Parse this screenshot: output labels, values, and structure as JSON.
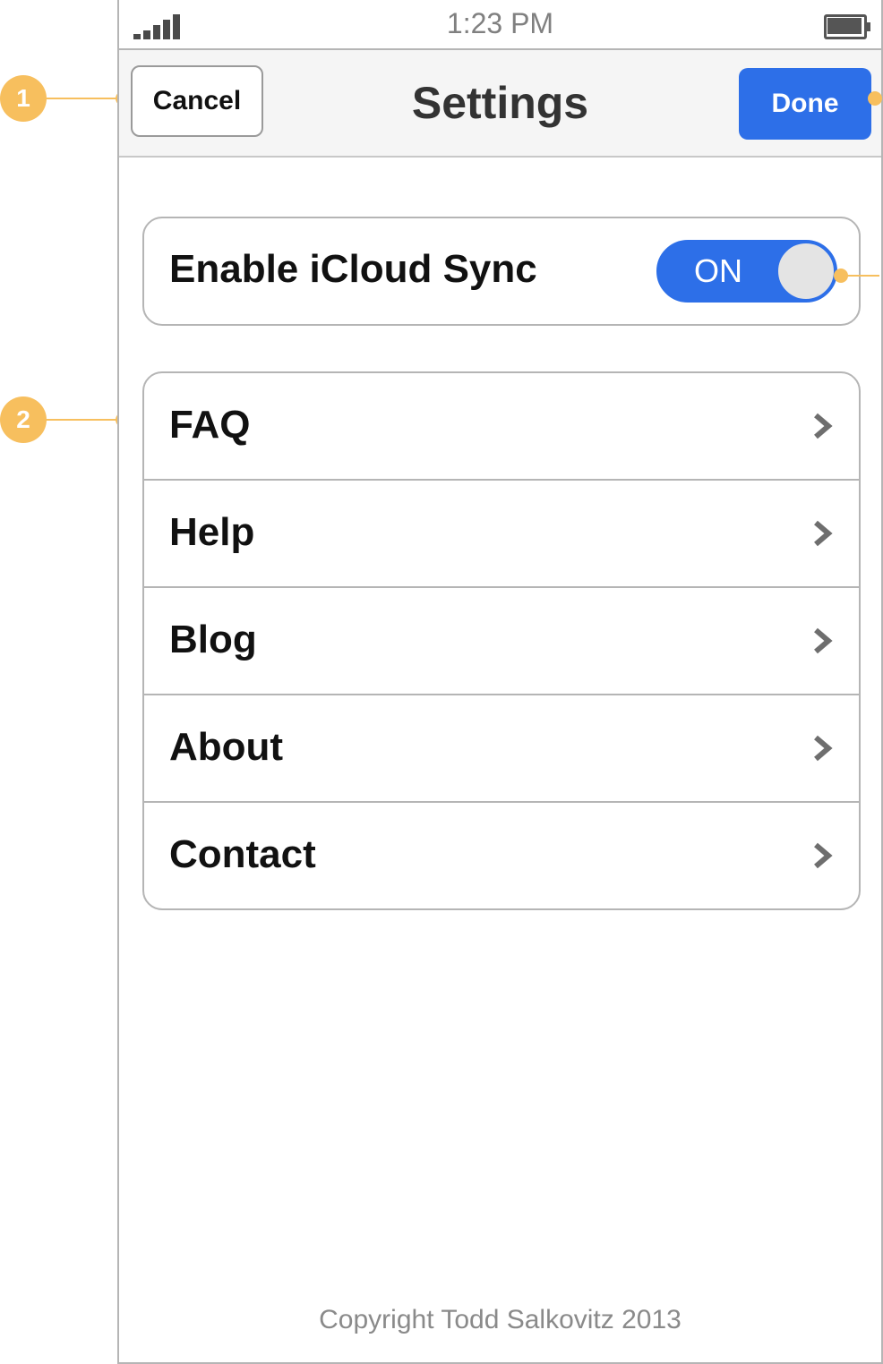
{
  "annotations": {
    "callout_1": "1",
    "callout_2": "2",
    "color": "#f7bf5e"
  },
  "status_bar": {
    "time": "1:23 PM",
    "signal_icon": "signal-bars-icon",
    "battery_icon": "battery-icon"
  },
  "nav_bar": {
    "cancel_label": "Cancel",
    "title": "Settings",
    "done_label": "Done",
    "done_color": "#2d6fe8"
  },
  "sync": {
    "label": "Enable iCloud Sync",
    "toggle_text": "ON",
    "toggle_state": "on",
    "toggle_color": "#2d6fe8"
  },
  "menu": {
    "items": [
      {
        "label": "FAQ",
        "icon": "chevron-right-icon"
      },
      {
        "label": "Help",
        "icon": "chevron-right-icon"
      },
      {
        "label": "Blog",
        "icon": "chevron-right-icon"
      },
      {
        "label": "About",
        "icon": "chevron-right-icon"
      },
      {
        "label": "Contact",
        "icon": "chevron-right-icon"
      }
    ]
  },
  "footer": {
    "copyright": "Copyright Todd Salkovitz 2013"
  }
}
